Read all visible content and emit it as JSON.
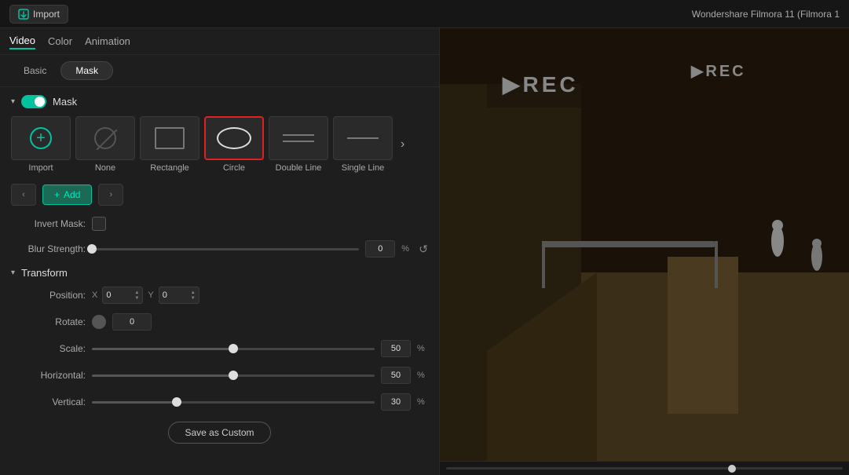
{
  "topbar": {
    "import_label": "Import",
    "app_title": "Wondershare Filmora 11 (Filmora 1"
  },
  "tabs": {
    "items": [
      "Video",
      "Color",
      "Animation"
    ],
    "active": "Video"
  },
  "sub_tabs": {
    "items": [
      "Basic",
      "Mask"
    ],
    "active": "Mask"
  },
  "mask_section": {
    "title": "Mask",
    "shapes": [
      {
        "id": "import",
        "label": "Import",
        "selected": false
      },
      {
        "id": "none",
        "label": "None",
        "selected": false
      },
      {
        "id": "rectangle",
        "label": "Rectangle",
        "selected": false
      },
      {
        "id": "circle",
        "label": "Circle",
        "selected": true
      },
      {
        "id": "double-line",
        "label": "Double Line",
        "selected": false
      },
      {
        "id": "single-line",
        "label": "Single Line",
        "selected": false
      }
    ]
  },
  "add_button": "+ Add",
  "properties": {
    "invert_mask_label": "Invert Mask:",
    "blur_strength_label": "Blur Strength:",
    "blur_value": "0",
    "blur_unit": "%"
  },
  "transform": {
    "title": "Transform",
    "position_label": "Position:",
    "x_label": "X",
    "x_value": "0",
    "y_label": "Y",
    "y_value": "0",
    "rotate_label": "Rotate:",
    "rotate_value": "0",
    "scale_label": "Scale:",
    "scale_value": "50",
    "scale_unit": "%",
    "horizontal_label": "Horizontal:",
    "horizontal_value": "50",
    "horizontal_unit": "%",
    "vertical_label": "Vertical:",
    "vertical_value": "30",
    "vertical_unit": "%"
  },
  "save_button": "Save as Custom"
}
